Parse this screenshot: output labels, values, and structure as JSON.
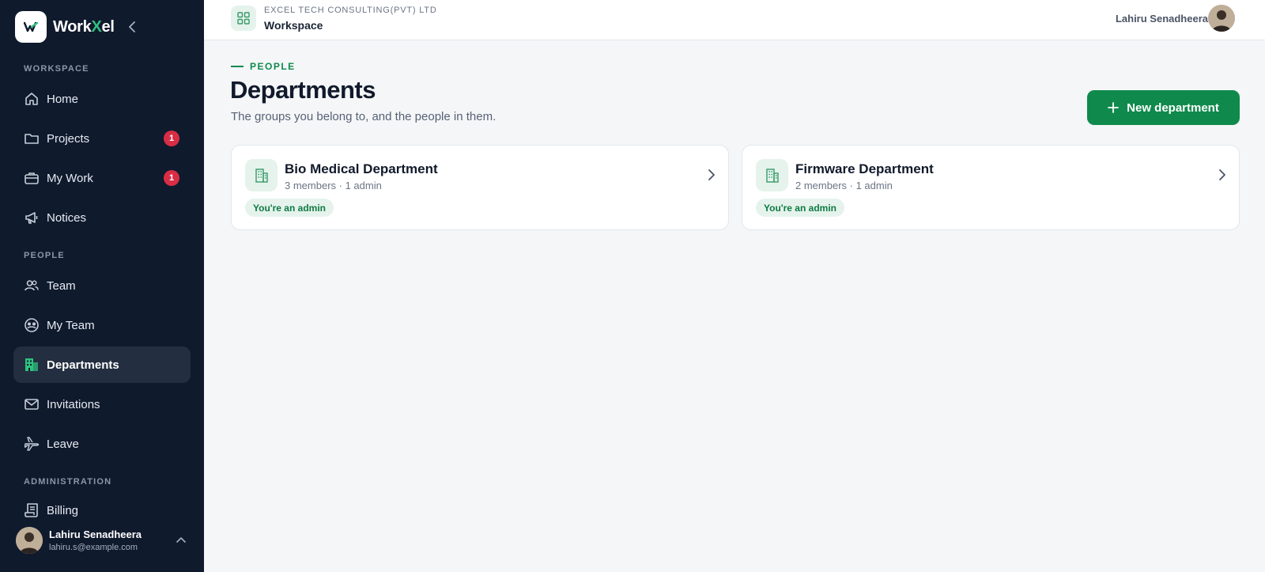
{
  "sidebar": {
    "brand": {
      "name_part1": "Work",
      "name_part2": "X",
      "name_part3": "el"
    },
    "sections": [
      {
        "label": "WORKSPACE"
      },
      {
        "label": "PEOPLE"
      },
      {
        "label": "ADMINISTRATION"
      }
    ],
    "items": [
      {
        "label": "Home",
        "icon": "home-icon"
      },
      {
        "label": "Projects",
        "icon": "folder-icon",
        "badge": "1"
      },
      {
        "label": "My Work",
        "icon": "briefcase-icon",
        "badge": "1"
      },
      {
        "label": "Notices",
        "icon": "megaphone-icon"
      },
      {
        "label": "Team",
        "icon": "users-icon"
      },
      {
        "label": "My Team",
        "icon": "team-circle-icon"
      },
      {
        "label": "Departments",
        "icon": "building-icon",
        "active": true
      },
      {
        "label": "Invitations",
        "icon": "mail-icon"
      },
      {
        "label": "Leave",
        "icon": "plane-icon"
      },
      {
        "label": "Billing",
        "icon": "receipt-icon"
      }
    ],
    "user": {
      "name": "Lahiru Senadheera",
      "email": "lahiru.s@example.com"
    }
  },
  "topbar": {
    "company": "EXCEL TECH CONSULTING(PVT) LTD",
    "workspace": "Workspace",
    "user_name": "Lahiru Senadheera"
  },
  "main": {
    "eyebrow": "PEOPLE",
    "title": "Departments",
    "subtitle": "The groups you belong to, and the people in them.",
    "new_button": "New department",
    "departments": [
      {
        "name": "Bio Medical Department",
        "meta": "3 members · 1 admin",
        "role": "You're an admin"
      },
      {
        "name": "Firmware Department",
        "meta": "2 members · 1 admin",
        "role": "You're an admin"
      }
    ]
  },
  "colors": {
    "sidebar_bg": "#101a2d",
    "accent": "#0f8a4c",
    "badge": "#d92d45",
    "page_bg": "#f4f6f8"
  }
}
